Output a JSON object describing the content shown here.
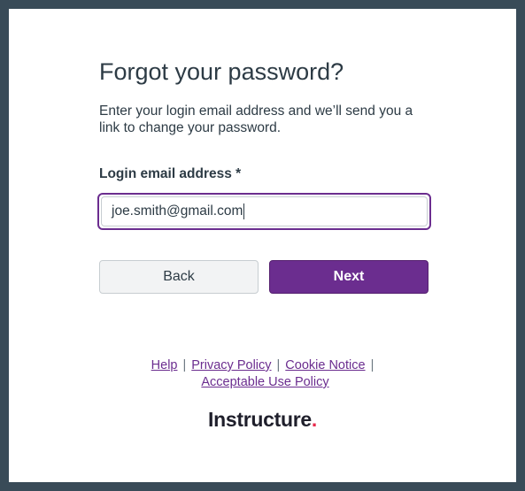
{
  "page": {
    "title": "Forgot your password?",
    "subtitle": "Enter your login email address and we’ll send you a link to change your password."
  },
  "form": {
    "email_label": "Login email address *",
    "email_value": "joe.smith@gmail.com"
  },
  "buttons": {
    "back_label": "Back",
    "next_label": "Next"
  },
  "footer": {
    "links": {
      "help": "Help",
      "privacy": "Privacy Policy",
      "cookie": "Cookie Notice",
      "acceptable_use": "Acceptable Use Policy"
    },
    "separator": "|"
  },
  "brand": {
    "name": "Instructure",
    "dot": ".",
    "accent_color": "#6b2d8f",
    "dot_color": "#e8294c"
  }
}
